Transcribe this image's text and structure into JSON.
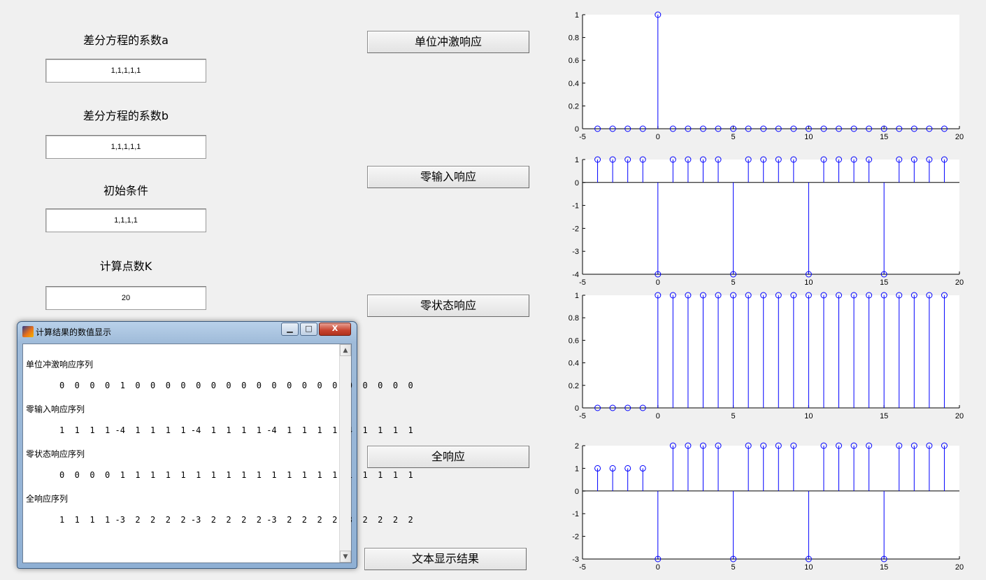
{
  "inputs": [
    {
      "label": "差分方程的系数a",
      "value": "1,1,1,1,1"
    },
    {
      "label": "差分方程的系数b",
      "value": "1,1,1,1,1"
    },
    {
      "label": "初始条件",
      "value": "1,1,1,1"
    },
    {
      "label": "计算点数K",
      "value": "20"
    }
  ],
  "buttons": {
    "impulse": "单位冲激响应",
    "zero_input": "零输入响应",
    "zero_state": "零状态响应",
    "full": "全响应",
    "text_display": "文本显示结果"
  },
  "popup": {
    "title": "计算结果的数值显示",
    "minimize_glyph": "▁",
    "maximize_glyph": "□",
    "close_glyph": "X",
    "sections": [
      {
        "heading": "单位冲激响应序列",
        "sequence": "0  0  0  0  1  0  0  0  0  0  0  0  0  0  0  0  0  0  0  0  0  0  0  0"
      },
      {
        "heading": "零输入响应序列",
        "sequence": "1  1  1  1 -4  1  1  1  1 -4  1  1  1  1 -4  1  1  1  1 -4  1  1  1  1"
      },
      {
        "heading": "零状态响应序列",
        "sequence": "0  0  0  0  1  1  1  1  1  1  1  1  1  1  1  1  1  1  1  1  1  1  1  1"
      },
      {
        "heading": "全响应序列",
        "sequence": "1  1  1  1 -3  2  2  2  2 -3  2  2  2  2 -3  2  2  2  2 -3  2  2  2  2"
      }
    ]
  },
  "chart_data": [
    {
      "type": "stem",
      "x": [
        -4,
        -3,
        -2,
        -1,
        0,
        1,
        2,
        3,
        4,
        5,
        6,
        7,
        8,
        9,
        10,
        11,
        12,
        13,
        14,
        15,
        16,
        17,
        18,
        19
      ],
      "values": [
        0,
        0,
        0,
        0,
        1,
        0,
        0,
        0,
        0,
        0,
        0,
        0,
        0,
        0,
        0,
        0,
        0,
        0,
        0,
        0,
        0,
        0,
        0,
        0
      ],
      "xlim": [
        -5,
        20
      ],
      "ylim": [
        0,
        1
      ],
      "xticks": [
        -5,
        0,
        5,
        10,
        15,
        20
      ],
      "yticks": [
        0,
        0.2,
        0.4,
        0.6,
        0.8,
        1
      ],
      "color": "#0000ff"
    },
    {
      "type": "stem",
      "x": [
        -4,
        -3,
        -2,
        -1,
        0,
        1,
        2,
        3,
        4,
        5,
        6,
        7,
        8,
        9,
        10,
        11,
        12,
        13,
        14,
        15,
        16,
        17,
        18,
        19
      ],
      "values": [
        1,
        1,
        1,
        1,
        -4,
        1,
        1,
        1,
        1,
        -4,
        1,
        1,
        1,
        1,
        -4,
        1,
        1,
        1,
        1,
        -4,
        1,
        1,
        1,
        1
      ],
      "xlim": [
        -5,
        20
      ],
      "ylim": [
        -4,
        1
      ],
      "xticks": [
        -5,
        0,
        5,
        10,
        15,
        20
      ],
      "yticks": [
        -4,
        -3,
        -2,
        -1,
        0,
        1
      ],
      "color": "#0000ff"
    },
    {
      "type": "stem",
      "x": [
        -4,
        -3,
        -2,
        -1,
        0,
        1,
        2,
        3,
        4,
        5,
        6,
        7,
        8,
        9,
        10,
        11,
        12,
        13,
        14,
        15,
        16,
        17,
        18,
        19
      ],
      "values": [
        0,
        0,
        0,
        0,
        1,
        1,
        1,
        1,
        1,
        1,
        1,
        1,
        1,
        1,
        1,
        1,
        1,
        1,
        1,
        1,
        1,
        1,
        1,
        1
      ],
      "xlim": [
        -5,
        20
      ],
      "ylim": [
        0,
        1
      ],
      "xticks": [
        -5,
        0,
        5,
        10,
        15,
        20
      ],
      "yticks": [
        0,
        0.2,
        0.4,
        0.6,
        0.8,
        1
      ],
      "color": "#0000ff"
    },
    {
      "type": "stem",
      "x": [
        -4,
        -3,
        -2,
        -1,
        0,
        1,
        2,
        3,
        4,
        5,
        6,
        7,
        8,
        9,
        10,
        11,
        12,
        13,
        14,
        15,
        16,
        17,
        18,
        19
      ],
      "values": [
        1,
        1,
        1,
        1,
        -3,
        2,
        2,
        2,
        2,
        -3,
        2,
        2,
        2,
        2,
        -3,
        2,
        2,
        2,
        2,
        -3,
        2,
        2,
        2,
        2
      ],
      "xlim": [
        -5,
        20
      ],
      "ylim": [
        -3,
        2
      ],
      "xticks": [
        -5,
        0,
        5,
        10,
        15,
        20
      ],
      "yticks": [
        -3,
        -2,
        -1,
        0,
        1,
        2
      ],
      "color": "#0000ff"
    }
  ]
}
